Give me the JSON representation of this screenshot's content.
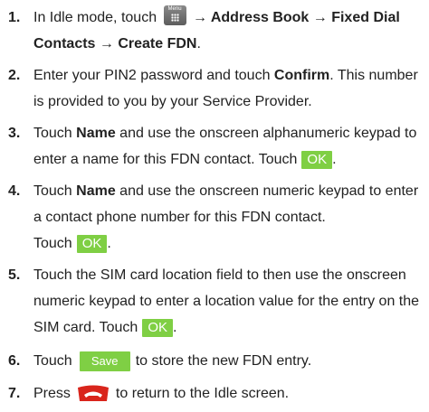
{
  "steps": [
    {
      "num": "1.",
      "a": "In Idle mode, touch",
      "menu_label": "Menu",
      "b": "→ Address Book → Fixed Dial Contacts → Create FDN",
      "c": "."
    },
    {
      "num": "2.",
      "a": "Enter your PIN2 password and touch ",
      "bold": "Confirm",
      "b": ". This number is provided to you by your Service Provider."
    },
    {
      "num": "3.",
      "a": "Touch ",
      "bold": "Name",
      "b": " and use the onscreen alphanumeric keypad to enter a name for this FDN contact. Touch",
      "ok": "OK",
      "c": "."
    },
    {
      "num": "4.",
      "a": "Touch ",
      "bold": "Name",
      "b": " and use the onscreen numeric keypad to enter a contact phone number for this FDN contact.",
      "c": "Touch",
      "ok": "OK",
      "d": "."
    },
    {
      "num": "5.",
      "a": "Touch the SIM card location field to then use the onscreen numeric keypad to enter a location value for the entry on the SIM card. Touch",
      "ok": "OK",
      "c": "."
    },
    {
      "num": "6.",
      "a": "Touch",
      "save": "Save",
      "b": "to store the new FDN entry."
    },
    {
      "num": "7.",
      "a": "Press",
      "b": "to return to the Idle screen."
    }
  ],
  "icons": {
    "menu": "menu-grid-icon",
    "end": "end-call-icon"
  },
  "colors": {
    "green_button": "#7fcf44",
    "end_button": "#d9251c"
  }
}
